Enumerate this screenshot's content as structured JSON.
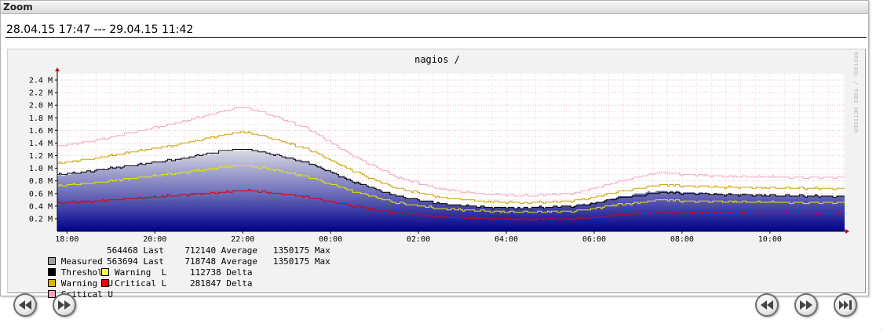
{
  "window": {
    "title": "Zoom"
  },
  "range": {
    "text": "28.04.15 17:47 --- 29.04.15 11:42"
  },
  "graph": {
    "title": "nagios /",
    "watermark": "RRDTOOL / TOBI OETIKER",
    "colors": {
      "background": "#f2f2f2",
      "plot": "#ffffff",
      "grid": "#e6b4b4",
      "area_top": "#dcdce4",
      "area_bottom": "#00008c",
      "measured_line": "#000000",
      "warning_u": "#c8a000",
      "warning_l": "#e8e800",
      "critical_u": "#f0a8c0",
      "critical_l": "#e00000",
      "axis_arrow": "#cc0000"
    }
  },
  "chart_data": {
    "type": "area",
    "title": "nagios /",
    "xlabel": "",
    "ylabel": "",
    "x_ticks": [
      "18:00",
      "20:00",
      "22:00",
      "00:00",
      "02:00",
      "04:00",
      "06:00",
      "08:00",
      "10:00"
    ],
    "x_range_hours": [
      17.78,
      35.7
    ],
    "y_ticks": [
      "0.2 M",
      "0.4 M",
      "0.6 M",
      "0.8 M",
      "1.0 M",
      "1.2 M",
      "1.4 M",
      "1.6 M",
      "1.8 M",
      "2.0 M",
      "2.2 M",
      "2.4 M"
    ],
    "ylim": [
      0,
      2500000
    ],
    "grid": true,
    "x": [
      17.78,
      18.5,
      19.5,
      20.5,
      21.5,
      22.0,
      22.5,
      23.5,
      24.5,
      25.5,
      26.5,
      27.5,
      28.5,
      29.5,
      30.0,
      30.5,
      31.0,
      31.5,
      32.0,
      33.0,
      34.0,
      35.0,
      35.7
    ],
    "series": [
      {
        "name": "Measured",
        "values": [
          880000,
          960000,
          1050000,
          1150000,
          1250000,
          1300000,
          1260000,
          1100000,
          800000,
          560000,
          440000,
          380000,
          370000,
          400000,
          450000,
          540000,
          600000,
          640000,
          620000,
          590000,
          570000,
          560000,
          560000
        ]
      },
      {
        "name": "Threshold",
        "values": [
          900000,
          950000,
          1050000,
          1140000,
          1270000,
          1310000,
          1250000,
          1080000,
          790000,
          560000,
          440000,
          380000,
          370000,
          400000,
          440000,
          520000,
          560000,
          620000,
          600000,
          580000,
          570000,
          560000,
          560000
        ]
      },
      {
        "name": "Warning  U",
        "values": [
          1080000,
          1140000,
          1260000,
          1370000,
          1520000,
          1580000,
          1500000,
          1300000,
          960000,
          680000,
          540000,
          470000,
          450000,
          480000,
          540000,
          620000,
          680000,
          740000,
          720000,
          700000,
          690000,
          680000,
          680000
        ]
      },
      {
        "name": "Warning  L",
        "values": [
          720000,
          760000,
          840000,
          920000,
          1010000,
          1050000,
          1000000,
          860000,
          640000,
          450000,
          360000,
          320000,
          300000,
          320000,
          360000,
          420000,
          450000,
          500000,
          480000,
          470000,
          460000,
          450000,
          450000
        ]
      },
      {
        "name": "Critical U",
        "values": [
          1350000,
          1420000,
          1570000,
          1720000,
          1900000,
          1970000,
          1880000,
          1620000,
          1200000,
          860000,
          670000,
          590000,
          560000,
          600000,
          680000,
          780000,
          860000,
          940000,
          900000,
          870000,
          860000,
          850000,
          850000
        ]
      },
      {
        "name": "Critical L",
        "values": [
          450000,
          470000,
          520000,
          570000,
          620000,
          650000,
          620000,
          540000,
          400000,
          290000,
          230000,
          200000,
          190000,
          200000,
          220000,
          260000,
          280000,
          300000,
          290000,
          285000,
          282000,
          282000,
          282000
        ]
      }
    ]
  },
  "legend": {
    "rows": [
      {
        "name": "Measured",
        "color": "#a0a0a0",
        "text": "564468 Last    712140 Average   1350175 Max"
      },
      {
        "name": "Threshold",
        "color": "#000000",
        "text": "563694 Last    718748 Average   1350175 Max"
      },
      {
        "name": "Warning  U",
        "color": "#e0b000",
        "name2": "Warning  L",
        "color2": "#ffff40",
        "text": "112738 Delta"
      },
      {
        "name": "Critical U",
        "color": "#f5a0b5",
        "name2": "Critical L",
        "color2": "#ee0000",
        "text": "281847 Delta"
      }
    ]
  },
  "nav": {
    "left": [
      {
        "icon": "rewind-icon",
        "label": "back"
      },
      {
        "icon": "fast-forward-icon",
        "label": "forward"
      }
    ],
    "right": [
      {
        "icon": "rewind-icon",
        "label": "back"
      },
      {
        "icon": "fast-forward-icon",
        "label": "forward"
      },
      {
        "icon": "skip-to-end-icon",
        "label": "end"
      }
    ]
  }
}
